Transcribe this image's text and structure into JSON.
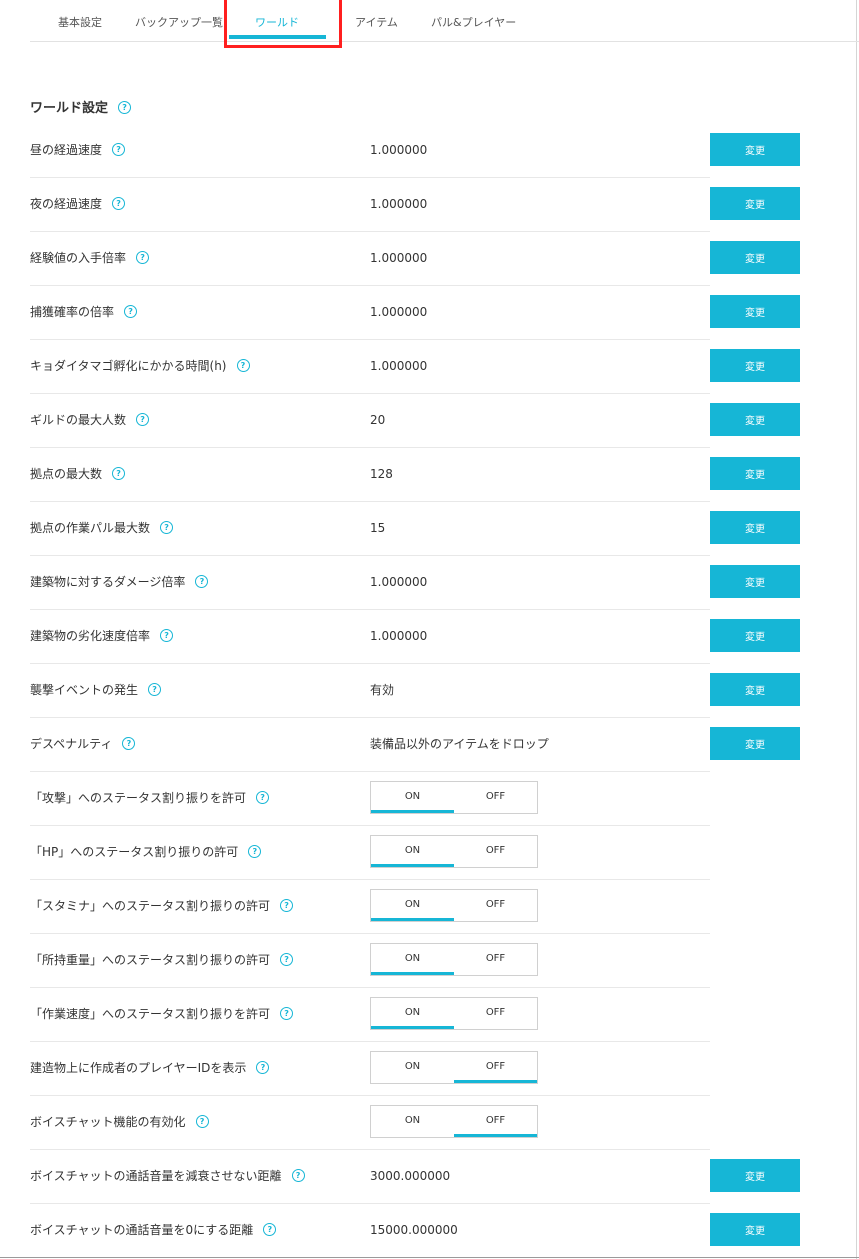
{
  "tabs": [
    {
      "label": "基本設定",
      "active": false
    },
    {
      "label": "バックアップ一覧",
      "active": false
    },
    {
      "label": "ワールド",
      "active": true
    },
    {
      "label": "アイテム",
      "active": false
    },
    {
      "label": "パル&プレイヤー",
      "active": false
    }
  ],
  "section": {
    "title": "ワールド設定",
    "help": "?"
  },
  "accent_color": "#16b6d6",
  "highlight_color": "#ff1f1f",
  "change_label": "変更",
  "toggle_labels": {
    "on": "ON",
    "off": "OFF"
  },
  "settings": [
    {
      "label": "昼の経過速度",
      "value": "1.000000"
    },
    {
      "label": "夜の経過速度",
      "value": "1.000000"
    },
    {
      "label": "経験値の入手倍率",
      "value": "1.000000"
    },
    {
      "label": "捕獲確率の倍率",
      "value": "1.000000"
    },
    {
      "label": "キョダイタマゴ孵化にかかる時間(h)",
      "value": "1.000000"
    },
    {
      "label": "ギルドの最大人数",
      "value": "20"
    },
    {
      "label": "拠点の最大数",
      "value": "128"
    },
    {
      "label": "拠点の作業パル最大数",
      "value": "15"
    },
    {
      "label": "建築物に対するダメージ倍率",
      "value": "1.000000"
    },
    {
      "label": "建築物の劣化速度倍率",
      "value": "1.000000"
    },
    {
      "label": "襲撃イベントの発生",
      "value": "有効"
    },
    {
      "label": "デスペナルティ",
      "value": "装備品以外のアイテムをドロップ"
    },
    {
      "label": "「攻撃」へのステータス割り振りを許可",
      "toggle": "ON"
    },
    {
      "label": "「HP」へのステータス割り振りの許可",
      "toggle": "ON"
    },
    {
      "label": "「スタミナ」へのステータス割り振りの許可",
      "toggle": "ON"
    },
    {
      "label": "「所持重量」へのステータス割り振りの許可",
      "toggle": "ON"
    },
    {
      "label": "「作業速度」へのステータス割り振りを許可",
      "toggle": "ON"
    },
    {
      "label": "建造物上に作成者のプレイヤーIDを表示",
      "toggle": "OFF"
    },
    {
      "label": "ボイスチャット機能の有効化",
      "toggle": "OFF"
    },
    {
      "label": "ボイスチャットの通話音量を減衰させない距離",
      "value": "3000.000000"
    },
    {
      "label": "ボイスチャットの通話音量を0にする距離",
      "value": "15000.000000"
    }
  ]
}
